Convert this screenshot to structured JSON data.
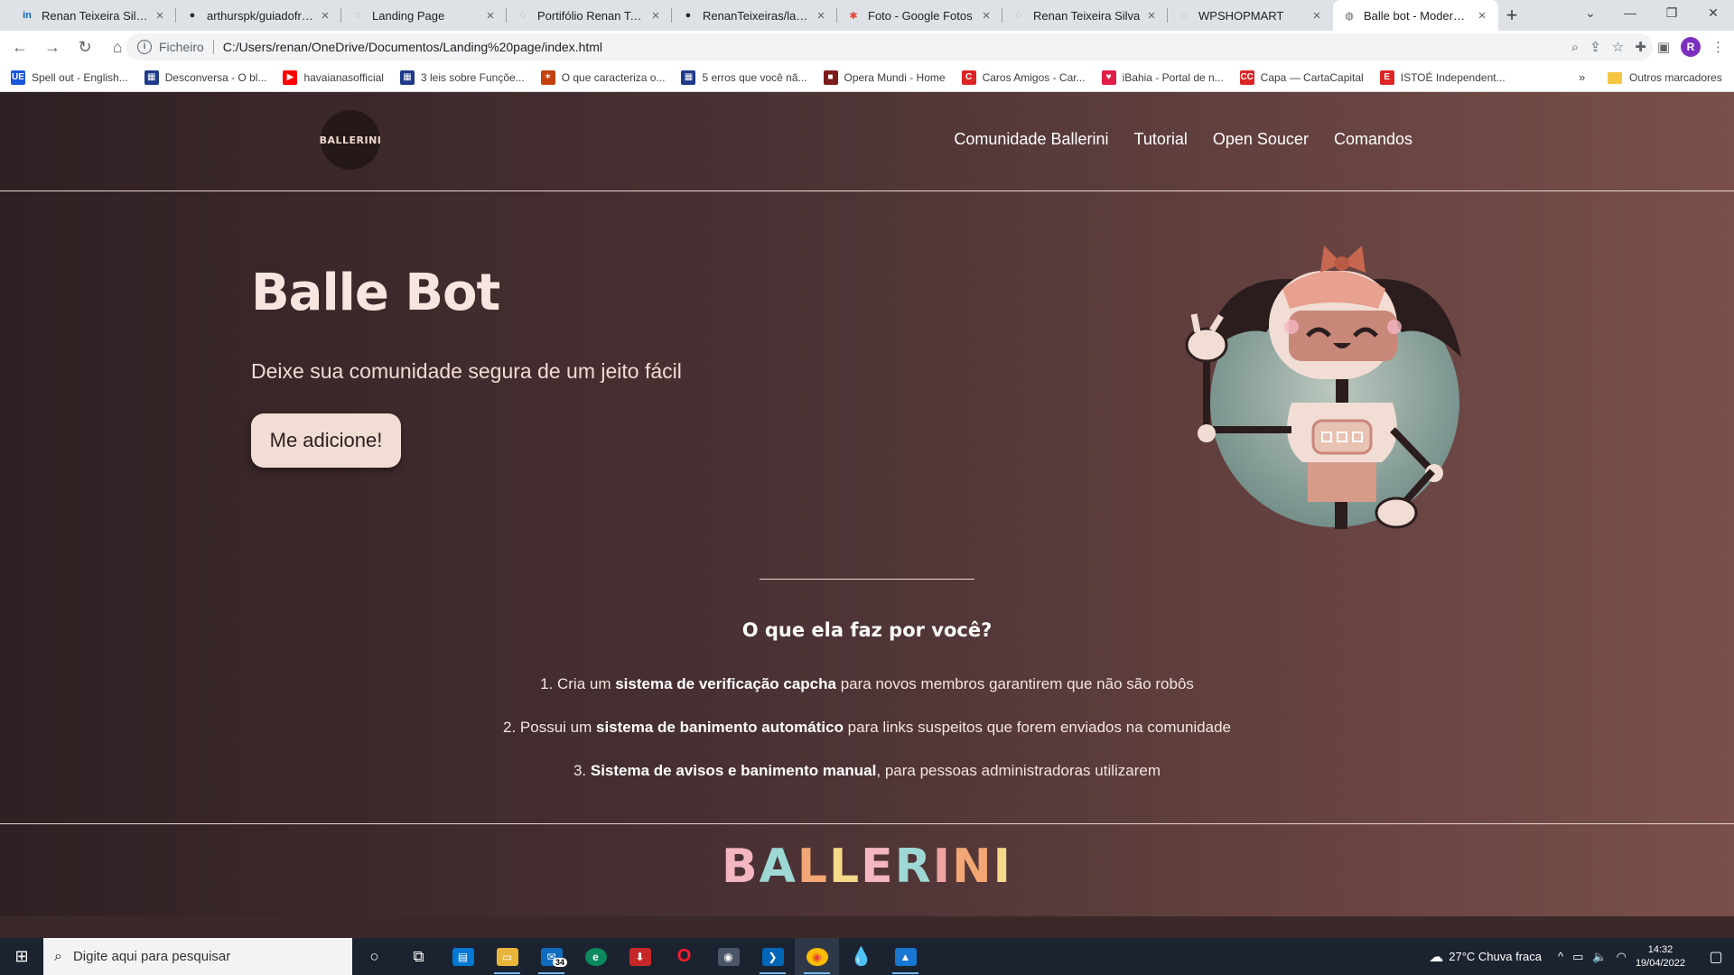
{
  "browser": {
    "tabs": [
      {
        "title": "Renan Teixeira Silva | LinkedIn",
        "icon": "linkedin-icon",
        "color": "#0a66c2",
        "glyph": "in"
      },
      {
        "title": "arthurspk/guiadofrontend",
        "icon": "github-icon",
        "color": "#24292f",
        "glyph": "●"
      },
      {
        "title": "Landing Page",
        "icon": "globe-icon",
        "color": "#9aa0a6",
        "glyph": "◌"
      },
      {
        "title": "Portifólio Renan Teixeira",
        "icon": "globe-icon",
        "color": "#9aa0a6",
        "glyph": "◌"
      },
      {
        "title": "RenanTeixeiras/landing-page",
        "icon": "github-icon",
        "color": "#24292f",
        "glyph": "●"
      },
      {
        "title": "Foto - Google Fotos",
        "icon": "google-photos-icon",
        "color": "#ea4335",
        "glyph": "✱"
      },
      {
        "title": "Renan Teixeira Silva",
        "icon": "globe-icon",
        "color": "#9aa0a6",
        "glyph": "◌"
      },
      {
        "title": "WPSHOPMART",
        "icon": "globe-icon",
        "color": "#9aa0a6",
        "glyph": "◌"
      },
      {
        "title": "Balle bot - Modere a sua comunidade",
        "icon": "globe-icon",
        "color": "#5f6368",
        "glyph": "◍"
      }
    ],
    "address": {
      "scheme": "Ficheiro",
      "url": "C:/Users/renan/OneDrive/Documentos/Landing%20page/index.html"
    },
    "bookmarks": [
      {
        "label": "Spell out - English...",
        "icon": "ue-icon",
        "color": "#1a56db",
        "glyph": "UE"
      },
      {
        "label": "Desconversa - O bl...",
        "icon": "grid-icon",
        "color": "#1f3a8a",
        "glyph": "▦"
      },
      {
        "label": "havaianasofficial",
        "icon": "youtube-icon",
        "color": "#ff0000",
        "glyph": "▶"
      },
      {
        "label": "3 leis sobre Funçõe...",
        "icon": "grid-icon",
        "color": "#1f3a8a",
        "glyph": "▦"
      },
      {
        "label": "O que caracteriza o...",
        "icon": "star-burst-icon",
        "color": "#c2410c",
        "glyph": "✶"
      },
      {
        "label": "5 erros que você nã...",
        "icon": "grid-icon",
        "color": "#1f3a8a",
        "glyph": "▦"
      },
      {
        "label": "Opera Mundi - Home",
        "icon": "opera-mundi-icon",
        "color": "#7f1d1d",
        "glyph": "■"
      },
      {
        "label": "Caros Amigos - Car...",
        "icon": "caros-amigos-icon",
        "color": "#dc2626",
        "glyph": "C"
      },
      {
        "label": "iBahia - Portal de n...",
        "icon": "ibahia-icon",
        "color": "#e11d48",
        "glyph": "♥"
      },
      {
        "label": "Capa — CartaCapital",
        "icon": "cartacapital-icon",
        "color": "#dc2626",
        "glyph": "CC"
      },
      {
        "label": "ISTOÉ Independent...",
        "icon": "istoe-icon",
        "color": "#dc2626",
        "glyph": "E"
      }
    ],
    "more_bookmarks": "»",
    "other_bookmarks": "Outros marcadores",
    "profile_initial": "R"
  },
  "site": {
    "logo_text": "BALLERINI",
    "nav": [
      "Comunidade Ballerini",
      "Tutorial",
      "Open Soucer",
      "Comandos"
    ],
    "hero": {
      "title": "Balle Bot",
      "subtitle": "Deixe sua comunidade segura de um jeito fácil",
      "cta": "Me adicione!"
    },
    "features": {
      "title": "O que ela faz por você?",
      "items": [
        {
          "prefix": "1. Cria um ",
          "bold": "sistema de verificação capcha",
          "suffix": " para novos membros garantirem que não são robôs"
        },
        {
          "prefix": "2. Possui um ",
          "bold": "sistema de banimento automático",
          "suffix": " para links suspeitos que forem enviados na comunidade"
        },
        {
          "prefix": "3. ",
          "bold": "Sistema de avisos e banimento manual",
          "suffix": ", para pessoas administradoras utilizarem"
        }
      ]
    },
    "footer_brand": {
      "letters": [
        "B",
        "A",
        "L",
        "L",
        "E",
        "R",
        "I",
        "N",
        "I"
      ],
      "colors": [
        "#f4b6c2",
        "#9ed8d4",
        "#f2a774",
        "#f6d98a",
        "#f4b6c2",
        "#9ed8d4",
        "#f0a1a1",
        "#f2a774",
        "#f6d98a"
      ]
    }
  },
  "taskbar": {
    "search_placeholder": "Digite aqui para pesquisar",
    "mail_badge": "34",
    "weather": "27°C  Chuva fraca",
    "time": "14:32",
    "date": "19/04/2022"
  }
}
